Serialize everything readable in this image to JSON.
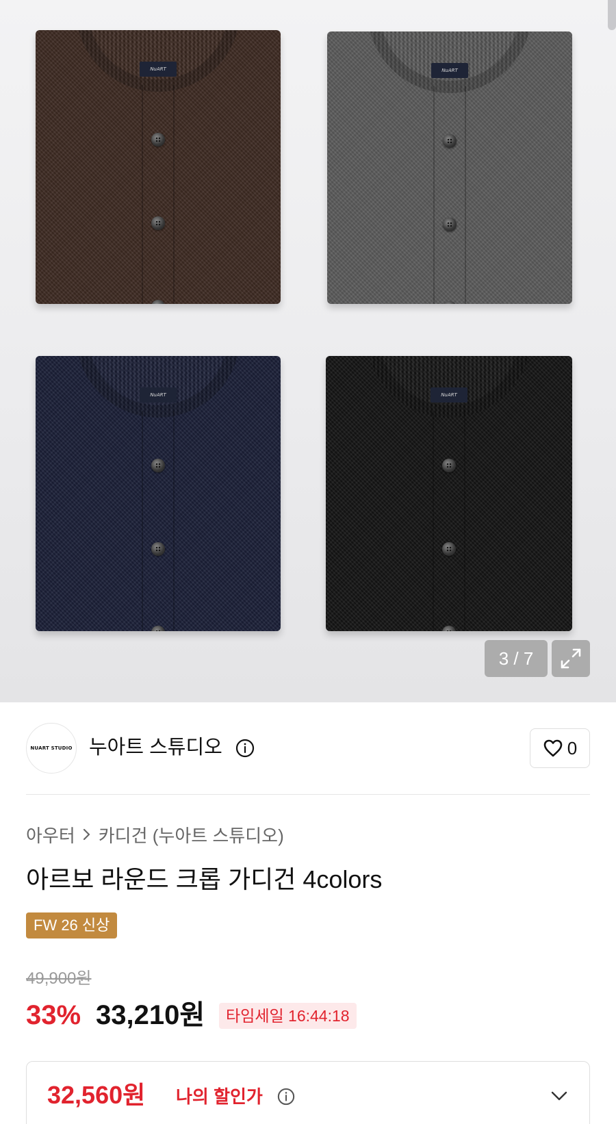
{
  "gallery": {
    "counter": "3 / 7",
    "expand_icon": "expand-icon",
    "colors": [
      "#3d2a22",
      "#5b5b5b",
      "#1a1f37",
      "#141414"
    ]
  },
  "brand": {
    "logo_text": "NUART STUDIO",
    "name": "누아트 스튜디오",
    "info_icon": "info-icon",
    "like_icon": "heart-icon",
    "like_count": "0"
  },
  "product": {
    "breadcrumb": [
      "아우터",
      "카디건 (누아트 스튜디오)"
    ],
    "title": "아르보 라운드 크롭 가디건 4colors",
    "badge": "FW 26 신상",
    "original_price": "49,900원",
    "discount_rate": "33%",
    "sale_price": "33,210원",
    "time_sale": "타임세일 16:44:18"
  },
  "my_price": {
    "price": "32,560원",
    "label": "나의 할인가",
    "info_icon": "info-icon",
    "toggle_icon": "chevron-down-icon"
  },
  "colors": {
    "accent_red": "#e1232e",
    "badge_gold": "#c28a3f",
    "time_sale_bg": "#fde9ea"
  }
}
